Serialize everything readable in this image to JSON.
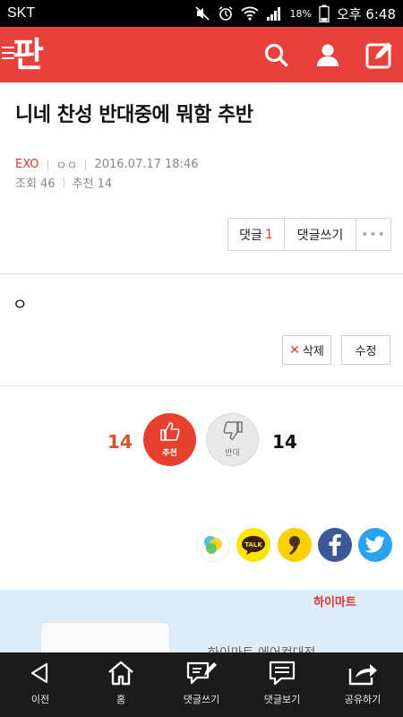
{
  "status_bar": {
    "carrier": "SKT",
    "battery": "18%",
    "time": "오후 6:48"
  },
  "app": {
    "logo_text": "판",
    "icons": [
      "search-icon",
      "user-icon",
      "write-icon"
    ]
  },
  "post": {
    "title": "니네 찬성 반대중에 뭐함 추반",
    "category": "EXO",
    "author": "ㅇㅇ",
    "date": "2016.07.17 18:46",
    "views_label": "조회 46",
    "recommend_label": "추천 14",
    "content": "ㅇ"
  },
  "actions": {
    "comment_label": "댓글",
    "comment_count": "1",
    "write_comment_label": "댓글쓰기",
    "more_label": "•••",
    "delete_label": "삭제",
    "edit_label": "수정"
  },
  "vote": {
    "up_count": "14",
    "up_label": "추천",
    "down_label": "반대",
    "down_count": "14"
  },
  "share": [
    "line-icon",
    "kakaotalk-icon",
    "kakaostory-icon",
    "facebook-icon",
    "twitter-icon"
  ],
  "share_labels": {
    "kakaotalk": "TALK"
  },
  "ad": {
    "brand": "하이마트",
    "text": "하이마트 에어컨대전"
  },
  "bottom_nav": [
    {
      "label": "이전",
      "icon": "back-icon"
    },
    {
      "label": "홈",
      "icon": "home-icon"
    },
    {
      "label": "댓글쓰기",
      "icon": "write-comment-icon"
    },
    {
      "label": "댓글보기",
      "icon": "view-comments-icon"
    },
    {
      "label": "공유하기",
      "icon": "share-icon"
    }
  ],
  "colors": {
    "brand_red": "#e8413b",
    "vote_up": "#e6412f",
    "facebook": "#3b5998",
    "twitter": "#2aa3ef",
    "kakao": "#fde500"
  }
}
